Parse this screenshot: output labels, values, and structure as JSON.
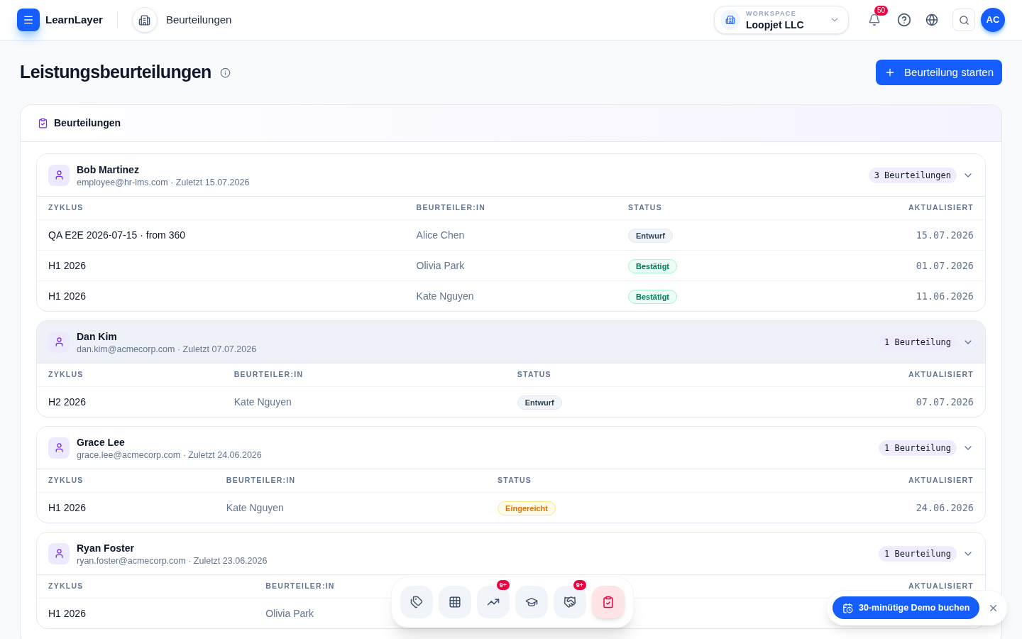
{
  "header": {
    "brand": "LearnLayer",
    "breadcrumb": "Beurteilungen",
    "workspace": {
      "label": "WORKSPACE",
      "name": "Loopjet LLC"
    },
    "notifications": "50",
    "avatar": "AC"
  },
  "page": {
    "title": "Leistungsbeurteilungen",
    "primary_button": "Beurteilung starten"
  },
  "panel": {
    "title": "Beurteilungen",
    "groups": [
      {
        "name": "Bob Martinez",
        "meta": "employee@hr-lms.com · Zuletzt 15.07.2026",
        "count": "3 Beurteilungen",
        "highlighted": false,
        "columns": {
          "cycle": "ZYKLUS",
          "reviewer": "BEURTEILER:IN",
          "status": "STATUS",
          "updated": "AKTUALISIERT"
        },
        "rows": [
          {
            "cycle": "QA E2E 2026-07-15 · from 360",
            "reviewer": "Alice Chen",
            "status": {
              "label": "Entwurf",
              "kind": "draft"
            },
            "updated": "15.07.2026"
          },
          {
            "cycle": "H1 2026",
            "reviewer": "Olivia Park",
            "status": {
              "label": "Bestätigt",
              "kind": "confirmed"
            },
            "updated": "01.07.2026"
          },
          {
            "cycle": "H1 2026",
            "reviewer": "Kate Nguyen",
            "status": {
              "label": "Bestätigt",
              "kind": "confirmed"
            },
            "updated": "11.06.2026"
          }
        ]
      },
      {
        "name": "Dan Kim",
        "meta": "dan.kim@acmecorp.com · Zuletzt 07.07.2026",
        "count": "1 Beurteilung",
        "highlighted": true,
        "columns": {
          "cycle": "ZYKLUS",
          "reviewer": "BEURTEILER:IN",
          "status": "STATUS",
          "updated": "AKTUALISIERT"
        },
        "rows": [
          {
            "cycle": "H2 2026",
            "reviewer": "Kate Nguyen",
            "status": {
              "label": "Entwurf",
              "kind": "draft"
            },
            "updated": "07.07.2026"
          }
        ]
      },
      {
        "name": "Grace Lee",
        "meta": "grace.lee@acmecorp.com · Zuletzt 24.06.2026",
        "count": "1 Beurteilung",
        "highlighted": false,
        "columns": {
          "cycle": "ZYKLUS",
          "reviewer": "BEURTEILER:IN",
          "status": "STATUS",
          "updated": "AKTUALISIERT"
        },
        "rows": [
          {
            "cycle": "H1 2026",
            "reviewer": "Kate Nguyen",
            "status": {
              "label": "Eingereicht",
              "kind": "submitted"
            },
            "updated": "24.06.2026"
          }
        ]
      },
      {
        "name": "Ryan Foster",
        "meta": "ryan.foster@acmecorp.com · Zuletzt 23.06.2026",
        "count": "1 Beurteilung",
        "highlighted": false,
        "columns": {
          "cycle": "ZYKLUS",
          "reviewer": "BEURTEILER:IN",
          "updated": "AKTUALISIERT"
        },
        "rows": [
          {
            "cycle": "H1 2026",
            "reviewer": "Olivia Park"
          }
        ]
      }
    ]
  },
  "dock": [
    {
      "kind": "tags",
      "selected": false
    },
    {
      "kind": "grid",
      "selected": false
    },
    {
      "kind": "trend",
      "badge": "9+",
      "selected": false
    },
    {
      "kind": "education",
      "selected": false
    },
    {
      "kind": "handshake",
      "badge": "9+",
      "selected": false
    },
    {
      "kind": "clipboard",
      "selected": true
    }
  ],
  "demo_popup": {
    "button": "30-minütige Demo buchen"
  }
}
